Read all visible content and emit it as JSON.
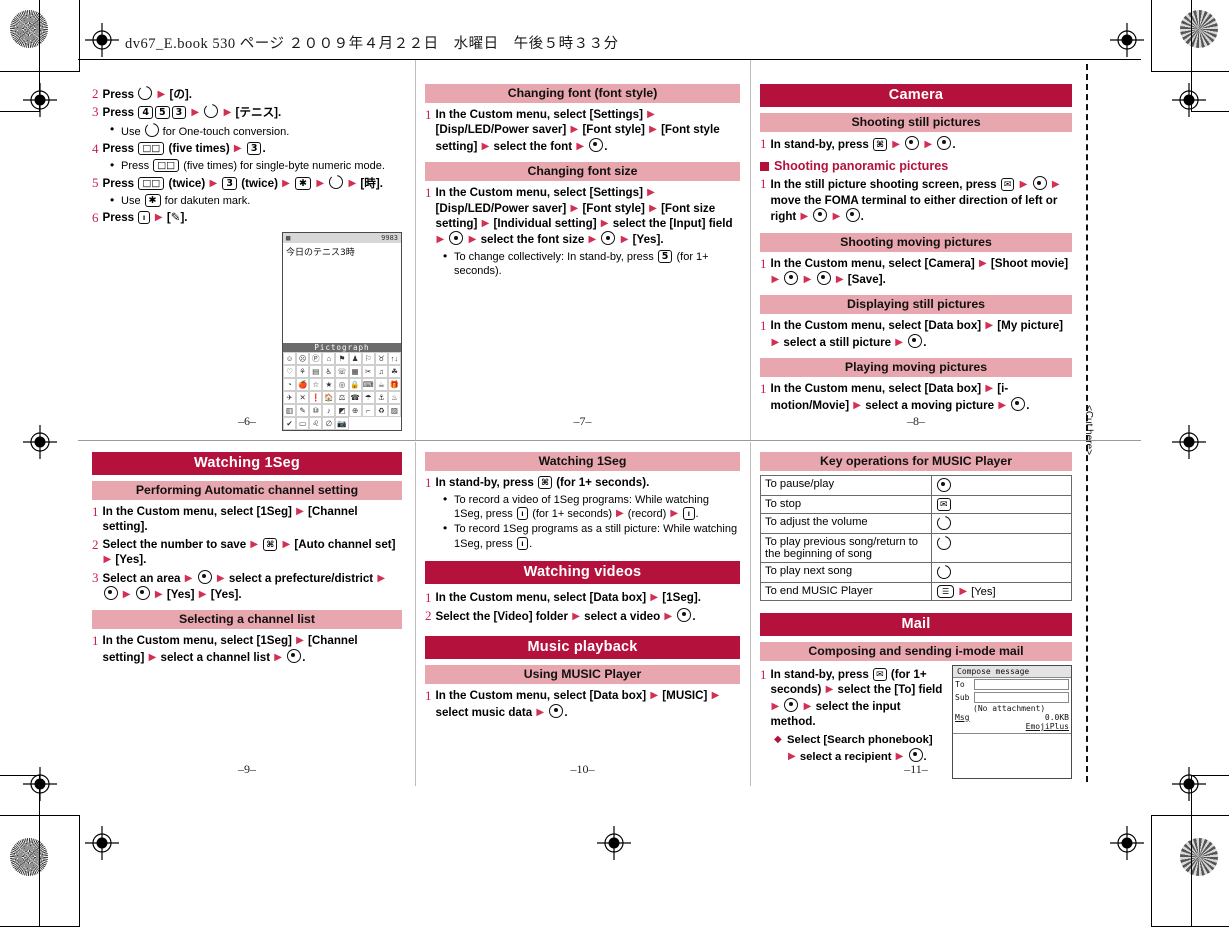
{
  "document": {
    "header_line": "dv67_E.book   530 ページ   ２００９年４月２２日　水曜日　午後５時３３分",
    "cut_here_label": "<Cut here>"
  },
  "pages": [
    {
      "number": "–6–",
      "steps": [
        {
          "num": "2",
          "text": "Press {RING} {ARW} [の]."
        },
        {
          "num": "3",
          "text": "Press {K4}{K5}{K3} {ARW} {RINGUP} {ARW} [テニス]."
        },
        {
          "num": "4",
          "text": "Press {KBOX} (five times) {ARW} {K3}."
        },
        {
          "num": "5",
          "text": "Press {KBOX} (twice) {ARW} {K3} (twice) {ARW} {KSTAR} {ARW} {RING} {ARW} [時]."
        },
        {
          "num": "6",
          "text": "Press {KI} {ARW} [{PEN}]."
        }
      ],
      "bullets_after_3": [
        "Use {RINGUP} for One-touch conversion."
      ],
      "bullets_after_4": [
        "Press {KBOX} (five times) for single-byte numeric mode."
      ],
      "bullets_after_5": [
        "Use {KSTAR} for dakuten mark."
      ],
      "screenshot": {
        "status_left_icon": "text-input-icon",
        "status_right": "9983",
        "body_text": "今日のテニス3時",
        "palette_title": "Pictograph",
        "palette_glyphs": [
          "☺",
          "☹",
          "Ⓟ",
          "⌂",
          "⚑",
          "♟",
          "⚐",
          "♉",
          "↑↓",
          "♡",
          "⚘",
          "▤",
          "♿",
          "☏",
          "▦",
          "✂",
          "♫",
          "☘",
          "◔",
          "🍎",
          "☆",
          "★",
          "◎",
          "🔒",
          "⌨",
          "☕",
          "🎁",
          "✈",
          "✕",
          "❗",
          "🏠",
          "⚖",
          "☎",
          "☂",
          "⚓",
          "♨",
          "▥",
          "✎",
          "⑩",
          "♪",
          "◩",
          "⊕",
          "⌐",
          "♻",
          "▨",
          "✔",
          "▭",
          "♌",
          "∅",
          "📷"
        ]
      }
    },
    {
      "number": "–7–",
      "sections": [
        {
          "heading": "Changing font (font style)",
          "level": "h2",
          "steps": [
            {
              "num": "1",
              "text": "In the Custom menu, select [Settings] {ARW} [Disp/LED/Power saver] {ARW} [Font style] {ARW} [Font style setting] {ARW} select the font {ARW} {KC}."
            }
          ],
          "bullets": []
        },
        {
          "heading": "Changing font size",
          "level": "h2",
          "steps": [
            {
              "num": "1",
              "text": "In the Custom menu, select [Settings] {ARW} [Disp/LED/Power saver] {ARW} [Font style] {ARW} [Font size setting] {ARW} [Individual setting] {ARW} select the [Input] field {ARW} {KC} {ARW} select the font size {ARW} {KC} {ARW} [Yes]."
            }
          ],
          "bullets": [
            "To change collectively: In stand-by, press {K5} (for 1+ seconds)."
          ]
        }
      ]
    },
    {
      "number": "–8–",
      "title": "Camera",
      "sections": [
        {
          "heading": "Shooting still pictures",
          "level": "h2",
          "steps": [
            {
              "num": "1",
              "text": "In stand-by, press {KCAM} {ARW} {KC} {ARW} {KC}."
            }
          ]
        },
        {
          "heading": "Shooting panoramic pictures",
          "level": "h3",
          "steps": [
            {
              "num": "1",
              "text": "In the still picture shooting screen, press {KMAIL} {ARW} {KC} {ARW} move the FOMA terminal to either direction of left or right {ARW} {KC} {ARW} {KC}."
            }
          ]
        },
        {
          "heading": "Shooting moving pictures",
          "level": "h2",
          "steps": [
            {
              "num": "1",
              "text": "In the Custom menu, select [Camera] {ARW} [Shoot movie] {ARW} {KC} {ARW} {KC} {ARW} [Save]."
            }
          ]
        },
        {
          "heading": "Displaying still pictures",
          "level": "h2",
          "steps": [
            {
              "num": "1",
              "text": "In the Custom menu, select [Data box] {ARW} [My picture] {ARW} select a still picture {ARW} {KC}."
            }
          ]
        },
        {
          "heading": "Playing moving pictures",
          "level": "h2",
          "steps": [
            {
              "num": "1",
              "text": "In the Custom menu, select [Data box] {ARW} [i-motion/Movie] {ARW} select a moving picture {ARW} {KC}."
            }
          ]
        }
      ]
    },
    {
      "number": "–9–",
      "title": "Watching 1Seg",
      "sections": [
        {
          "heading": "Performing Automatic channel setting",
          "level": "h2",
          "steps": [
            {
              "num": "1",
              "text": "In the Custom menu, select [1Seg] {ARW} [Channel setting]."
            },
            {
              "num": "2",
              "text": "Select the number to save {ARW} {KCAM} {ARW} [Auto channel set] {ARW} [Yes]."
            },
            {
              "num": "3",
              "text": "Select an area {ARW} {KC} {ARW} select a prefecture/district {ARW} {KC} {ARW} {KC} {ARW} [Yes] {ARW} [Yes]."
            }
          ]
        },
        {
          "heading": "Selecting a channel list",
          "level": "h2",
          "steps": [
            {
              "num": "1",
              "text": "In the Custom menu, select [1Seg] {ARW} [Channel setting] {ARW} select a channel list {ARW} {KC}."
            }
          ]
        }
      ]
    },
    {
      "number": "–10–",
      "sections": [
        {
          "heading": "Watching 1Seg",
          "level": "h2",
          "steps": [
            {
              "num": "1",
              "text": "In stand-by, press {KCAM} (for 1+ seconds)."
            }
          ],
          "bullets": [
            "To record a video of 1Seg programs: While watching 1Seg, press {KI} (for 1+ seconds) {ARW} (record) {ARW} {KI}.",
            "To record 1Seg programs as a still picture: While watching 1Seg, press {KI}."
          ]
        },
        {
          "heading": "Watching videos",
          "level": "h1",
          "steps": [
            {
              "num": "1",
              "text": "In the Custom menu, select [Data box] {ARW} [1Seg]."
            },
            {
              "num": "2",
              "text": "Select the [Video] folder {ARW} select a video {ARW} {KC}."
            }
          ]
        },
        {
          "heading": "Music playback",
          "level": "h1",
          "steps": []
        },
        {
          "heading": "Using MUSIC Player",
          "level": "h2",
          "steps": [
            {
              "num": "1",
              "text": "In the Custom menu, select [Data box] {ARW} [MUSIC] {ARW} select music data {ARW} {KC}."
            }
          ]
        }
      ]
    },
    {
      "number": "–11–",
      "sections": [
        {
          "heading": "Key operations for MUSIC Player",
          "level": "h2"
        },
        {
          "heading": "Mail",
          "level": "h1"
        },
        {
          "heading": "Composing and sending i-mode mail",
          "level": "h2",
          "steps": [
            {
              "num": "1",
              "text": "In stand-by, press {KMAIL} (for 1+ seconds) {ARW} select the [To] field {ARW} {KC} {ARW} select the input method."
            }
          ],
          "diamonds": [
            "Select [Search phonebook] {ARW} select a recipient {ARW} {KC}."
          ]
        }
      ],
      "key_operations_table": {
        "rows": [
          {
            "action": "To pause/play",
            "key": "{KC}"
          },
          {
            "action": "To stop",
            "key": "{KMAIL}"
          },
          {
            "action": "To adjust the volume",
            "key": "{RINGUP}"
          },
          {
            "action": "To play previous song/return to the beginning of song",
            "key": "{RINGL}"
          },
          {
            "action": "To play next song",
            "key": "{RINGR}"
          },
          {
            "action": "To end MUSIC Player",
            "key": "{KEND} {ARW} [Yes]"
          }
        ]
      },
      "mail_screenshot": {
        "title": "Compose message",
        "to_label": "To",
        "sub_label": "Sub",
        "attachment": "(No attachment)",
        "msg_label": "Msg",
        "size": "0.0KB",
        "emoji_link": "EmojiPlus"
      }
    }
  ],
  "colors": {
    "h1_bar": "#b4123c",
    "h2_bar": "#e8a6ae",
    "accent_red": "#b4123c",
    "step_number": "#c8204a",
    "arrow": "#d32f53"
  }
}
